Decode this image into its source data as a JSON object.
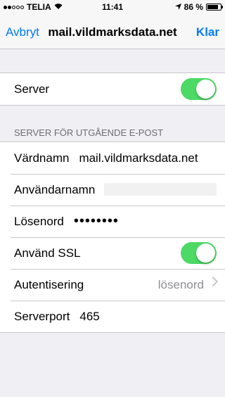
{
  "status": {
    "carrier": "TELIA",
    "time": "11:41",
    "battery": "86 %",
    "battery_level": 0.86
  },
  "nav": {
    "cancel": "Avbryt",
    "title": "mail.vildmarksdata.net",
    "done": "Klar"
  },
  "server_group": {
    "label": "Server",
    "enabled": true
  },
  "outgoing": {
    "header": "SERVER FÖR UTGÅENDE E-POST",
    "hostname_label": "Värdnamn",
    "hostname_value": "mail.vildmarksdata.net",
    "username_label": "Användarnamn",
    "password_label": "Lösenord",
    "password_mask": "••••••••",
    "ssl_label": "Använd SSL",
    "ssl_enabled": true,
    "auth_label": "Autentisering",
    "auth_value": "lösenord",
    "port_label": "Serverport",
    "port_value": "465"
  }
}
